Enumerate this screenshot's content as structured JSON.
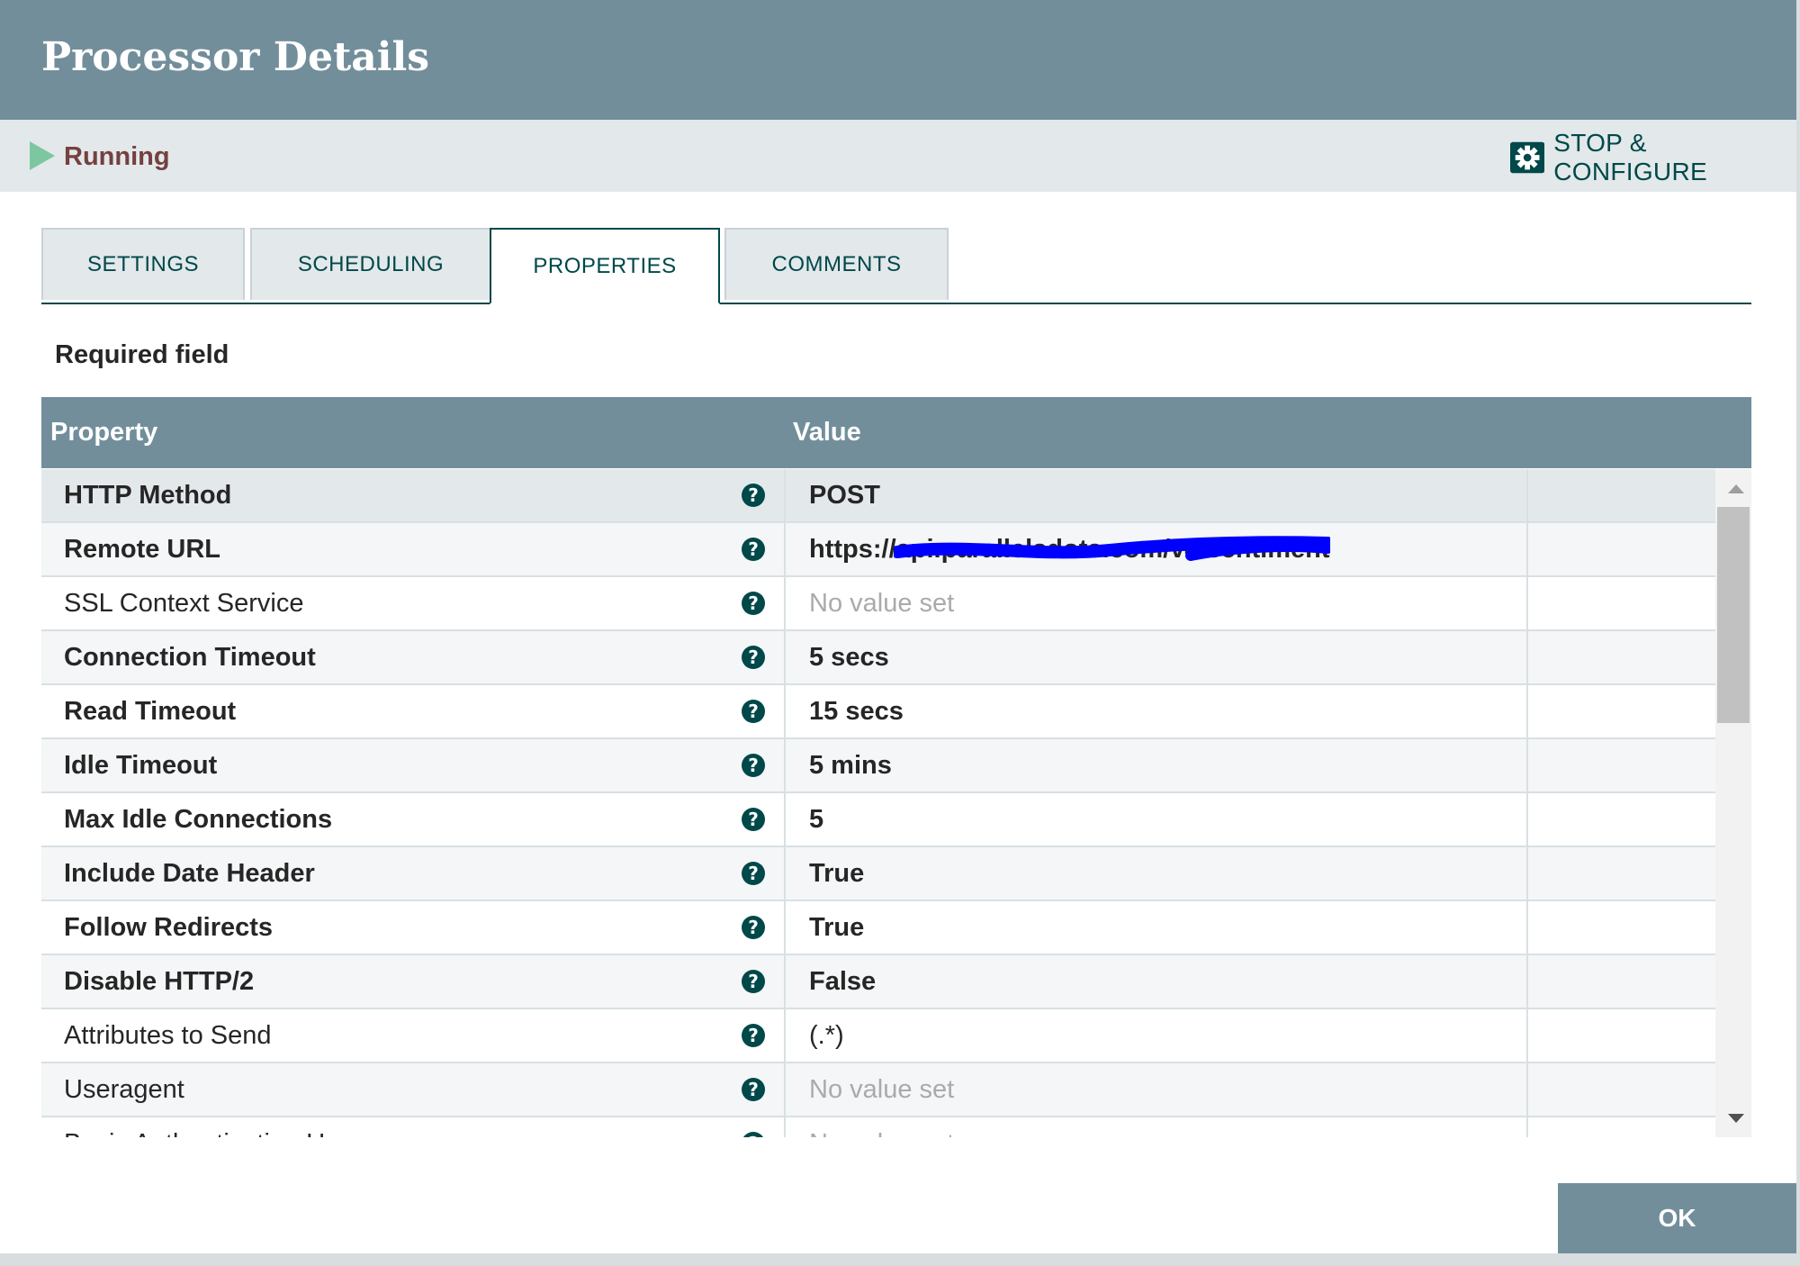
{
  "dialog": {
    "title": "Processor Details"
  },
  "status": {
    "state": "Running",
    "action_label": "STOP & CONFIGURE"
  },
  "tabs": [
    {
      "label": "SETTINGS",
      "active": false
    },
    {
      "label": "SCHEDULING",
      "active": false
    },
    {
      "label": "PROPERTIES",
      "active": true
    },
    {
      "label": "COMMENTS",
      "active": false
    }
  ],
  "required_label": "Required field",
  "table": {
    "columns": [
      "Property",
      "Value"
    ],
    "rows": [
      {
        "name": "HTTP Method",
        "value": "POST",
        "required": true
      },
      {
        "name": "Remote URL",
        "value": "https://api.parallelsdots.com/v4/sentiment",
        "required": true
      },
      {
        "name": "SSL Context Service",
        "value": "No value set",
        "required": false
      },
      {
        "name": "Connection Timeout",
        "value": "5 secs",
        "required": true
      },
      {
        "name": "Read Timeout",
        "value": "15 secs",
        "required": true
      },
      {
        "name": "Idle Timeout",
        "value": "5 mins",
        "required": true
      },
      {
        "name": "Max Idle Connections",
        "value": "5",
        "required": true
      },
      {
        "name": "Include Date Header",
        "value": "True",
        "required": true
      },
      {
        "name": "Follow Redirects",
        "value": "True",
        "required": true
      },
      {
        "name": "Disable HTTP/2",
        "value": "False",
        "required": true
      },
      {
        "name": "Attributes to Send",
        "value": "(.*)",
        "required": false
      },
      {
        "name": "Useragent",
        "value": "No value set",
        "required": false
      },
      {
        "name": "Basic Authentication Username",
        "value": "No value set",
        "required": false
      }
    ]
  },
  "footer": {
    "ok_label": "OK"
  },
  "colors": {
    "header_bg": "#728e9b",
    "accent": "#004849",
    "running": "#7dc7a0",
    "status_text": "#75403f",
    "redaction": "#0000ff"
  }
}
